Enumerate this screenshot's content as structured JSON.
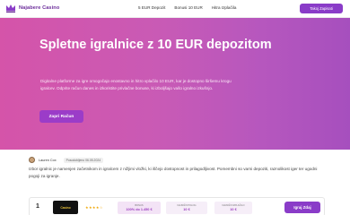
{
  "nav": {
    "logo_text": "Najabere Casino",
    "links": [
      "5 EUR Depozit",
      "Bonusi 10 EUR",
      "Hitra Izplačila"
    ],
    "cta": "Takoj Zapisati"
  },
  "hero": {
    "title": "Spletne igralnice z 10 EUR depozitom",
    "text": "Digitalne platforme za igre omogočajo enostavno in hitro vplačilo 10 EUR, kar je dostopno širšemu krogu igralcev. Odprite račun danes in izkoristite privlačne bonuse, ki izboljšajo vašo igralno izkušnjo.",
    "button": "Zapri Račun"
  },
  "author": {
    "name": "Lauren Cox",
    "date": "Posodobljeno 06.05.2024"
  },
  "intro": "Izbor igralnic je namenjen začetnikom in igralcem z nižjimi vložki, ki iščejo dostopnost in prilagodljivost. Pomembni so varni depoziti, raznolikost iger ter ugodni pogoji za igranje.",
  "listing": {
    "rank": "1",
    "brand": "Casino",
    "rating_stars": "★★★★☆",
    "stats": [
      {
        "label": "BONUS",
        "value": "100% do 1.450 €"
      },
      {
        "label": "NAJNIŽJI POLOG",
        "value": "10 €"
      },
      {
        "label": "NAJNIŽJI IZPLAČILO",
        "value": "10 €"
      }
    ],
    "cta": "Igraj Zdaj"
  }
}
